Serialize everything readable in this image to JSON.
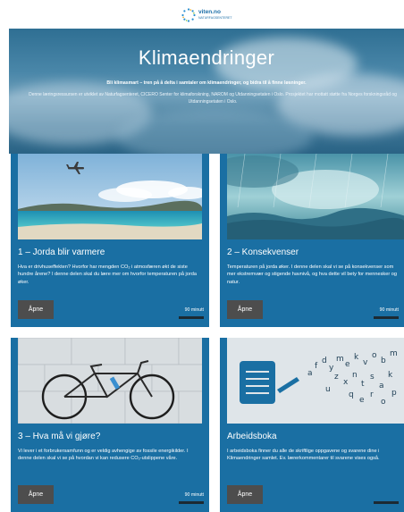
{
  "logo": {
    "name": "viten.no",
    "tagline": "NATURFAGSENTERET"
  },
  "hero": {
    "title": "Klimaendringer",
    "lead": "Bli klimasmart – tren på å delta i samtaler om klimaendringer, og bidra til å finne løsninger.",
    "text": "Denne læringsressursen er utviklet av Naturfagsenteret, CICERO Senter for klimaforskning, NAROM og Utdanningsetaten i Oslo. Prosjektet har mottatt støtte fra Norges forskningsråd og Utdanningsetaten i Oslo."
  },
  "cards": [
    {
      "title": "1 – Jorda blir varmere",
      "description": "Hva er drivhuseffekten? Hvorfor har mengden CO₂ i atmosfæren økt de siste hundre årene? I denne delen skal du lære mer om hvorfor temperaturen på jorda øker.",
      "button": "Åpne",
      "duration": "90 minutt"
    },
    {
      "title": "2 – Konsekvenser",
      "description": "Temperaturen på jorda øker. I denne delen skal vi se på konsekvenser som mer ekstremvær og stigende havnivå, og hva dette vil bety for mennesker og natur.",
      "button": "Åpne",
      "duration": "90 minutt"
    },
    {
      "title": "3 – Hva må vi gjøre?",
      "description": "Vi lever i et forbrukersamfunn og er veldig avhengige av fossile energikilder. I denne delen skal vi se på hvordan vi kan redusere CO₂-utslippene våre.",
      "button": "Åpne",
      "duration": "90 minutt"
    },
    {
      "title": "Arbeidsboka",
      "description": "I arbeidsboka finner du alle de skriftlige oppgavene og svarene dine i Klimaendringer samlet. Ev. lærerkommentarer til svarene vises også.",
      "button": "Åpne",
      "duration": ""
    }
  ],
  "colors": {
    "card": "#1a6fa3",
    "button": "#4d4d4d",
    "hero": "#3d7697"
  }
}
